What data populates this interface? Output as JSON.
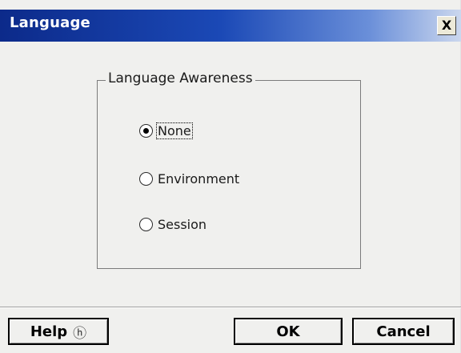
{
  "window": {
    "title": "Language",
    "close_label": "X",
    "close_icon": "close-icon"
  },
  "group": {
    "legend": "Language Awareness",
    "options": [
      {
        "label": "None",
        "selected": true
      },
      {
        "label": "Environment",
        "selected": false
      },
      {
        "label": "Session",
        "selected": false
      }
    ]
  },
  "buttons": {
    "help_label": "Help",
    "help_icon": "help-circle-icon",
    "help_glyph": "?",
    "ok_label": "OK",
    "cancel_label": "Cancel"
  }
}
